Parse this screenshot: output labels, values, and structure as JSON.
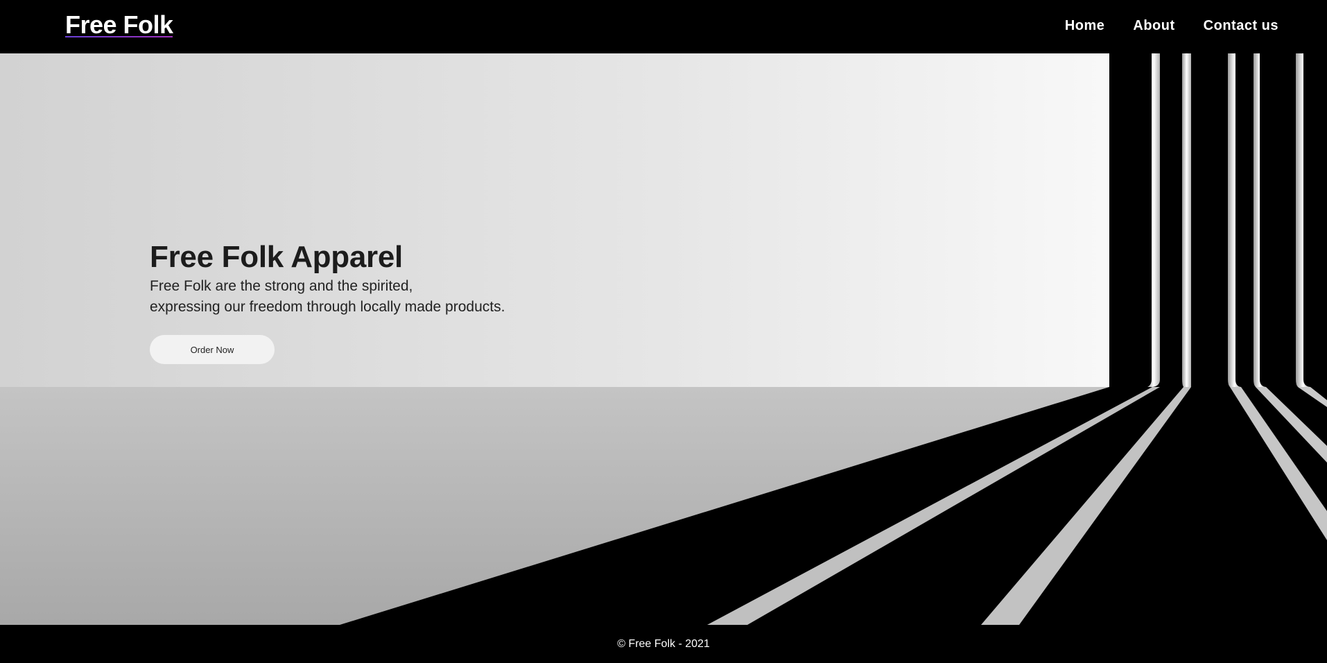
{
  "header": {
    "brand": "Free Folk",
    "nav": [
      {
        "label": "Home"
      },
      {
        "label": "About"
      },
      {
        "label": "Contact us"
      }
    ]
  },
  "hero": {
    "title": "Free Folk Apparel",
    "lines": [
      "Free Folk are the strong and the spirited,",
      "expressing our freedom through locally made products."
    ],
    "cta": "Order Now"
  },
  "footer": {
    "copyright": "© Free Folk - 2021"
  },
  "colors": {
    "background": "#000000",
    "text_light": "#ffffff",
    "text_dark": "#1c1c1c",
    "brand_underline": "#7a3fd0"
  }
}
